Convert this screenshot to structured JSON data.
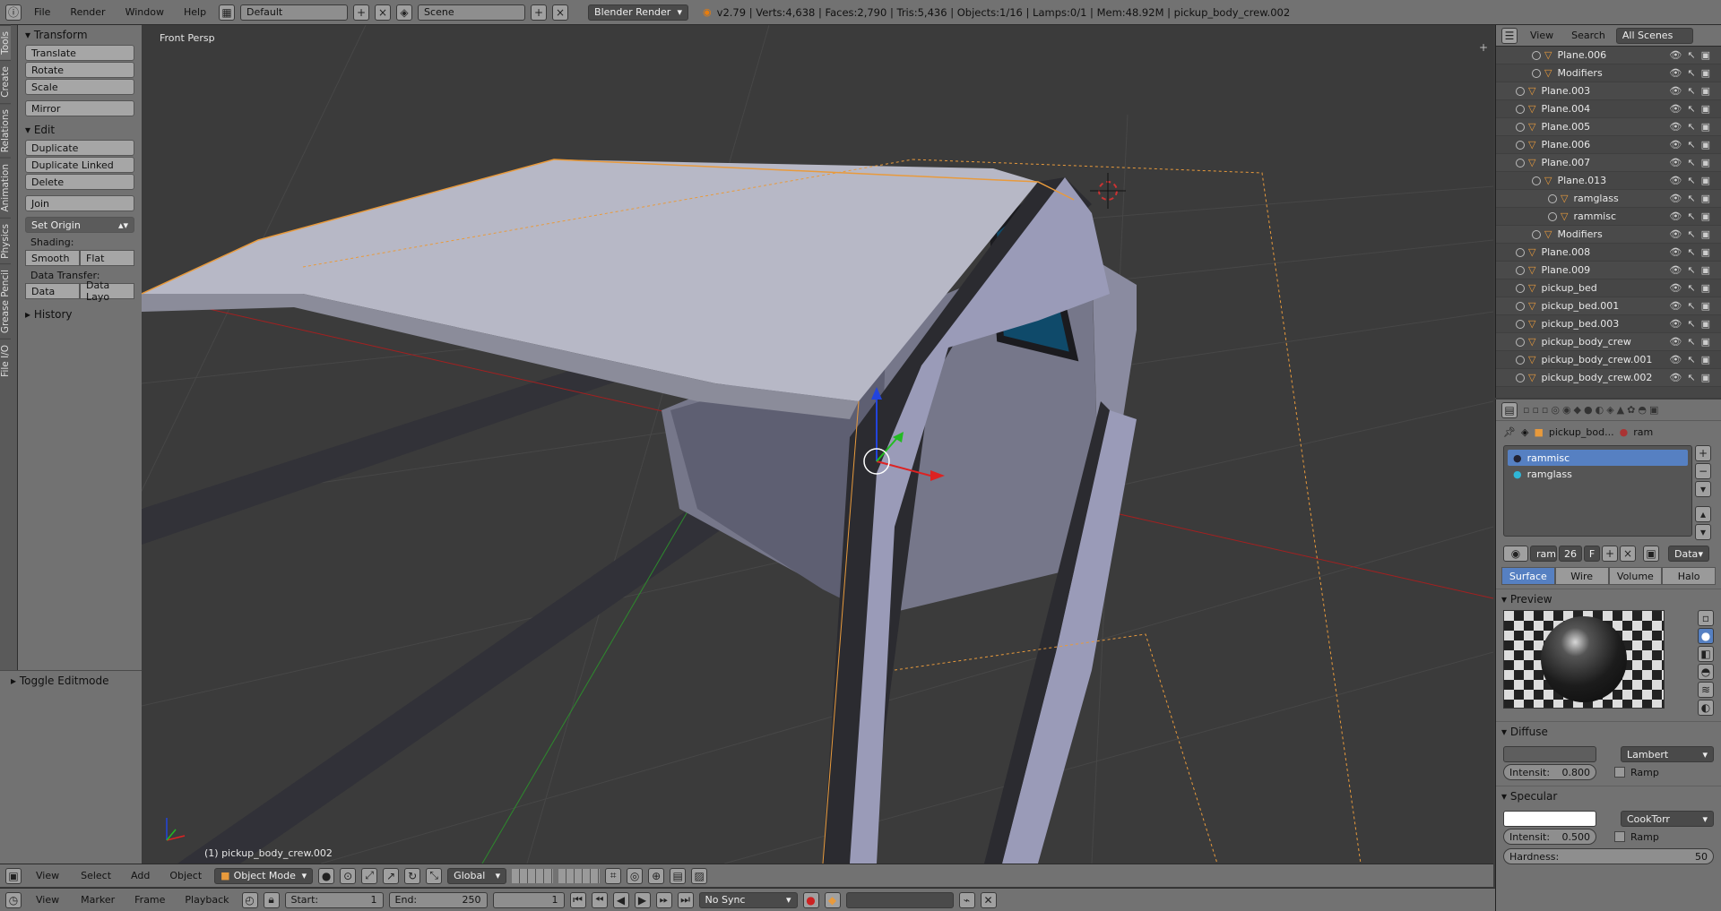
{
  "topbar": {
    "menus": [
      "File",
      "Render",
      "Window",
      "Help"
    ],
    "layout": "Default",
    "scene": "Scene",
    "engine": "Blender Render",
    "stats": "v2.79 | Verts:4,638 | Faces:2,790 | Tris:5,436 | Objects:1/16 | Lamps:0/1 | Mem:48.92M | pickup_body_crew.002"
  },
  "left_tabs": [
    "Tools",
    "Create",
    "Relations",
    "Animation",
    "Physics",
    "Grease Pencil",
    "File I/O"
  ],
  "tool_shelf": {
    "transform_header": "Transform",
    "transform_buttons": [
      "Translate",
      "Rotate",
      "Scale"
    ],
    "mirror": "Mirror",
    "edit_header": "Edit",
    "edit_buttons": [
      "Duplicate",
      "Duplicate Linked",
      "Delete"
    ],
    "join": "Join",
    "set_origin": "Set Origin",
    "shading_label": "Shading:",
    "smooth": "Smooth",
    "flat": "Flat",
    "data_transfer_label": "Data Transfer:",
    "data": "Data",
    "data_layo": "Data Layo",
    "history_header": "History",
    "toggle_editmode": "Toggle Editmode"
  },
  "viewport": {
    "view_name": "Front Persp",
    "object_label": "(1) pickup_body_crew.002"
  },
  "view3d_header": {
    "menus": [
      "View",
      "Select",
      "Add",
      "Object"
    ],
    "mode": "Object Mode",
    "orientation": "Global"
  },
  "timeline": {
    "menus": [
      "View",
      "Marker",
      "Frame",
      "Playback"
    ],
    "start_label": "Start:",
    "start": "1",
    "end_label": "End:",
    "end": "250",
    "current": "1",
    "sync": "No Sync"
  },
  "outliner": {
    "header_menus": [
      "View",
      "Search"
    ],
    "display": "All Scenes",
    "rows": [
      {
        "name": "Plane.006",
        "indent": 1
      },
      {
        "name": "Modifiers",
        "indent": 1
      },
      {
        "name": "Plane.003",
        "indent": 0
      },
      {
        "name": "Plane.004",
        "indent": 0
      },
      {
        "name": "Plane.005",
        "indent": 0
      },
      {
        "name": "Plane.006",
        "indent": 0
      },
      {
        "name": "Plane.007",
        "indent": 0
      },
      {
        "name": "Plane.013",
        "indent": 1
      },
      {
        "name": "ramglass",
        "indent": 2
      },
      {
        "name": "rammisc",
        "indent": 2
      },
      {
        "name": "Modifiers",
        "indent": 1
      },
      {
        "name": "Plane.008",
        "indent": 0
      },
      {
        "name": "Plane.009",
        "indent": 0
      },
      {
        "name": "pickup_bed",
        "indent": 0
      },
      {
        "name": "pickup_bed.001",
        "indent": 0
      },
      {
        "name": "pickup_bed.003",
        "indent": 0
      },
      {
        "name": "pickup_body_crew",
        "indent": 0
      },
      {
        "name": "pickup_body_crew.001",
        "indent": 0
      },
      {
        "name": "pickup_body_crew.002",
        "indent": 0
      }
    ]
  },
  "properties": {
    "breadcrumb_object": "pickup_bod...",
    "breadcrumb_material": "ram",
    "materials": [
      "rammisc",
      "ramglass"
    ],
    "material_name": "ram",
    "users": "26",
    "fake": "F",
    "link": "Data",
    "tabs": [
      "Surface",
      "Wire",
      "Volume",
      "Halo"
    ],
    "active_tab": "Surface",
    "preview_header": "Preview",
    "diffuse_header": "Diffuse",
    "diffuse_shader": "Lambert",
    "diffuse_intensity_label": "Intensit:",
    "diffuse_intensity": "0.800",
    "ramp": "Ramp",
    "specular_header": "Specular",
    "specular_shader": "CookTorr",
    "specular_intensity_label": "Intensit:",
    "specular_intensity": "0.500",
    "hardness_label": "Hardness:",
    "hardness": "50"
  }
}
